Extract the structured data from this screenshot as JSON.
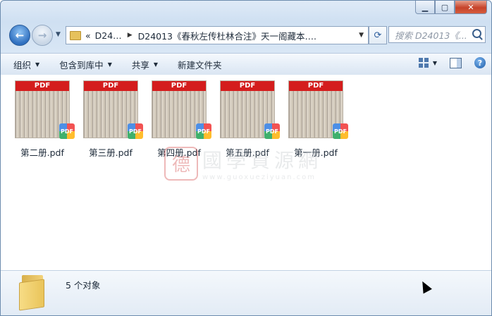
{
  "address": {
    "chevrons": "«",
    "crumb_1": "D24…",
    "crumb_2": "D24013《春秋左传杜林合注》天一阁藏本…."
  },
  "search": {
    "placeholder": "搜索 D24013《..."
  },
  "toolbar": {
    "organize": "组织",
    "include_in_library": "包含到库中",
    "share": "共享",
    "new_folder": "新建文件夹"
  },
  "files": [
    {
      "name": "第二册.pdf",
      "thumb_label": "PDF",
      "badge": "PDF"
    },
    {
      "name": "第三册.pdf",
      "thumb_label": "PDF",
      "badge": "PDF"
    },
    {
      "name": "第四册.pdf",
      "thumb_label": "PDF",
      "badge": "PDF"
    },
    {
      "name": "第五册.pdf",
      "thumb_label": "PDF",
      "badge": "PDF"
    },
    {
      "name": "第一册.pdf",
      "thumb_label": "PDF",
      "badge": "PDF"
    }
  ],
  "watermark": {
    "seal": "德",
    "title": "國學資源網",
    "url": "www.guoxueziyuan.com"
  },
  "status": {
    "count": "5 个对象"
  },
  "colors": {
    "pdf_band": "#d41d1d",
    "accent": "#2f6fbf"
  },
  "icons": [
    "back-arrow-icon",
    "forward-arrow-icon",
    "folder-icon",
    "refresh-icon",
    "search-icon",
    "view-options-icon",
    "preview-pane-icon",
    "help-icon"
  ]
}
